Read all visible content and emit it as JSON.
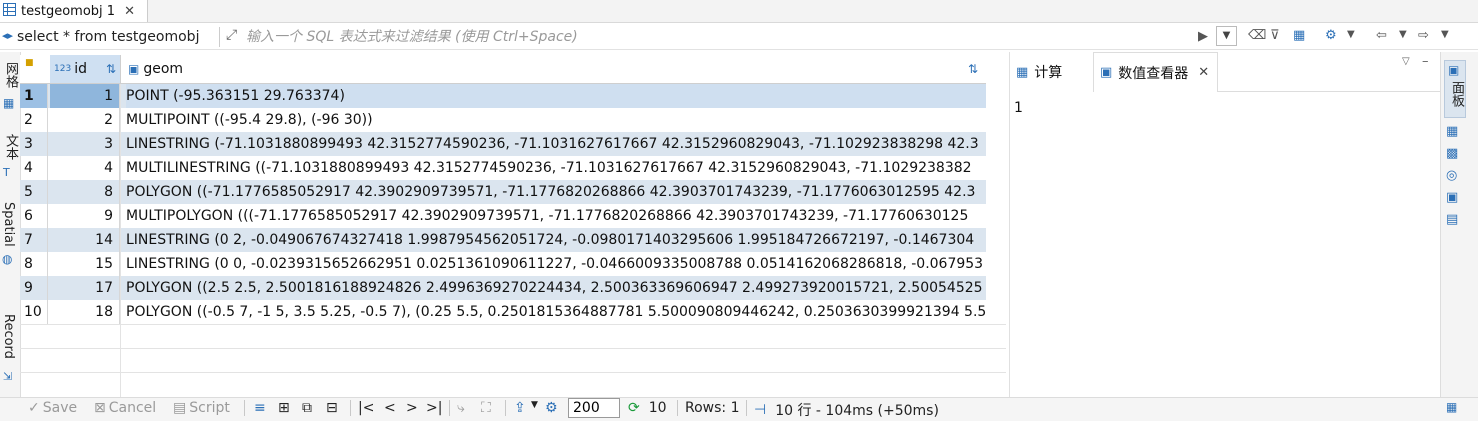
{
  "tab": {
    "title": "testgeomobj 1",
    "icon": "table-icon"
  },
  "query": {
    "text": "select * from testgeomobj",
    "filter_placeholder": "输入一个 SQL 表达式来过滤结果 (使用 Ctrl+Space)"
  },
  "left_strip": {
    "grid": "网格",
    "text": "文本",
    "spatial": "Spatial",
    "record": "Record"
  },
  "columns": [
    {
      "name": "id",
      "type_badge": "123"
    },
    {
      "name": "geom"
    }
  ],
  "rows": [
    {
      "rn": "1",
      "id": "1",
      "geom": "POINT (-95.363151 29.763374)"
    },
    {
      "rn": "2",
      "id": "2",
      "geom": "MULTIPOINT ((-95.4 29.8), (-96 30))"
    },
    {
      "rn": "3",
      "id": "3",
      "geom": "LINESTRING (-71.1031880899493 42.3152774590236, -71.1031627617667 42.3152960829043, -71.102923838298 42.3"
    },
    {
      "rn": "4",
      "id": "4",
      "geom": "MULTILINESTRING ((-71.1031880899493 42.3152774590236, -71.1031627617667 42.3152960829043, -71.1029238382"
    },
    {
      "rn": "5",
      "id": "8",
      "geom": "POLYGON ((-71.1776585052917 42.3902909739571, -71.1776820268866 42.3903701743239, -71.1776063012595 42.3"
    },
    {
      "rn": "6",
      "id": "9",
      "geom": "MULTIPOLYGON (((-71.1776585052917 42.3902909739571, -71.1776820268866 42.3903701743239, -71.17760630125"
    },
    {
      "rn": "7",
      "id": "14",
      "geom": "LINESTRING (0 2, -0.049067674327418 1.9987954562051724, -0.0980171403295606 1.995184726672197, -0.1467304"
    },
    {
      "rn": "8",
      "id": "15",
      "geom": "LINESTRING (0 0, -0.0239315652662951 0.0251361090611227, -0.0466009335008788 0.0514162068286818, -0.067953"
    },
    {
      "rn": "9",
      "id": "17",
      "geom": "POLYGON ((2.5 2.5, 2.5001816188924826 2.4996369270224434, 2.500363369606947 2.499273920015721, 2.50054525"
    },
    {
      "rn": "10",
      "id": "18",
      "geom": "POLYGON ((-0.5 7, -1 5, 3.5 5.25, -0.5 7), (0.25 5.5, 0.2501815364887781 5.500090809446242, 0.2503630399921394 5.5"
    }
  ],
  "right_panel": {
    "tabs": [
      {
        "label": "计算"
      },
      {
        "label": "数值查看器"
      }
    ],
    "value": "1",
    "side_label": "面板"
  },
  "bottom": {
    "save": "Save",
    "cancel": "Cancel",
    "script": "Script",
    "fetch_size": "200",
    "refresh_count": "10",
    "rows": "Rows: 1",
    "status": "10 行 - 104ms (+50ms)"
  }
}
